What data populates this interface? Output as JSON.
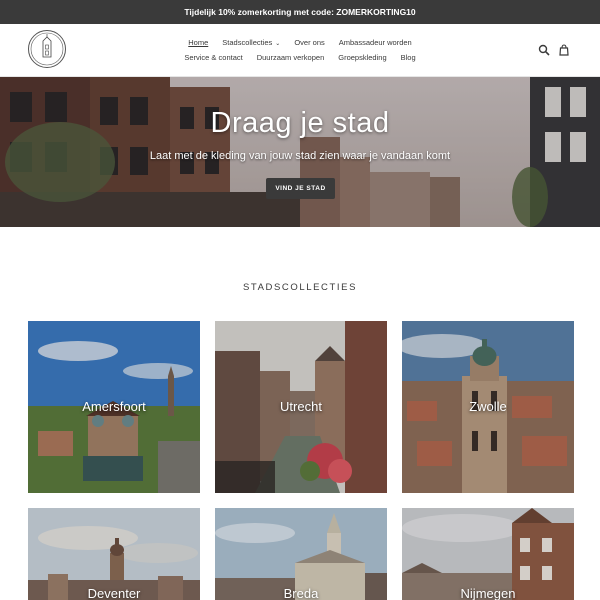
{
  "announcement": "Tijdelijk 10% zomerkorting met code: ZOMERKORTING10",
  "header": {
    "logo_text_top": "DRAAG JE",
    "logo_text_bottom": "STAD",
    "nav_row1": [
      {
        "label": "Home",
        "active": true
      },
      {
        "label": "Stadscollecties",
        "has_dropdown": true
      },
      {
        "label": "Over ons"
      },
      {
        "label": "Ambassadeur worden"
      }
    ],
    "nav_row2": [
      {
        "label": "Service & contact"
      },
      {
        "label": "Duurzaam verkopen"
      },
      {
        "label": "Groepskleding"
      },
      {
        "label": "Blog"
      }
    ],
    "icons": [
      "search-icon",
      "cart-icon"
    ]
  },
  "hero": {
    "title": "Draag je stad",
    "subtitle": "Laat met de kleding van jouw stad zien waar je vandaan komt",
    "button": "VIND JE STAD"
  },
  "collections": {
    "title": "STADSCOLLECTIES",
    "items": [
      {
        "name": "Amersfoort"
      },
      {
        "name": "Utrecht"
      },
      {
        "name": "Zwolle"
      },
      {
        "name": "Deventer"
      },
      {
        "name": "Breda"
      },
      {
        "name": "Nijmegen"
      }
    ]
  },
  "colors": {
    "dark": "#3a3a3a",
    "background": "#ffffff"
  }
}
